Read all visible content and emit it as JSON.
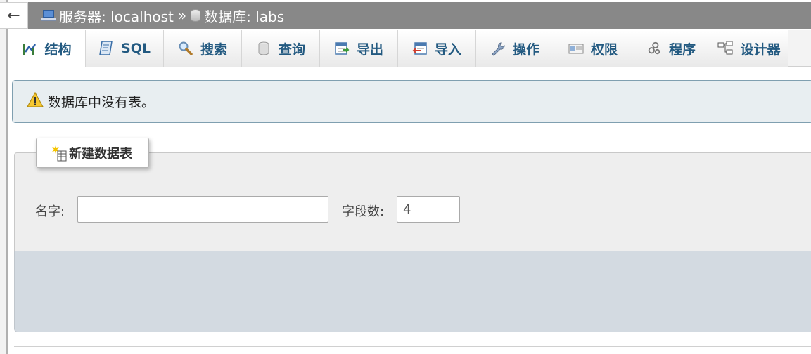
{
  "nav": {
    "back_glyph": "←"
  },
  "breadcrumb": {
    "server_label": "服务器: localhost",
    "separator": "»",
    "database_label": "数据库: labs"
  },
  "tabs": [
    {
      "label": "结构",
      "icon": "structure-icon"
    },
    {
      "label": "SQL",
      "icon": "sql-icon"
    },
    {
      "label": "搜索",
      "icon": "search-icon"
    },
    {
      "label": "查询",
      "icon": "query-icon"
    },
    {
      "label": "导出",
      "icon": "export-icon"
    },
    {
      "label": "导入",
      "icon": "import-icon"
    },
    {
      "label": "操作",
      "icon": "wrench-icon"
    },
    {
      "label": "权限",
      "icon": "privileges-icon"
    },
    {
      "label": "程序",
      "icon": "routines-icon"
    },
    {
      "label": "设计器",
      "icon": "designer-icon"
    }
  ],
  "notice": {
    "text": "数据库中没有表。",
    "icon": "warning-icon"
  },
  "create_table": {
    "legend": "新建数据表",
    "name_label": "名字:",
    "name_value": "",
    "columns_label": "字段数:",
    "columns_value": "4"
  },
  "colors": {
    "topbar": "#888888",
    "tab_text": "#235a81",
    "notice_bg": "#e8eef1",
    "fieldset_bg": "#eeeeee",
    "footer_bg": "#d3dae1"
  }
}
